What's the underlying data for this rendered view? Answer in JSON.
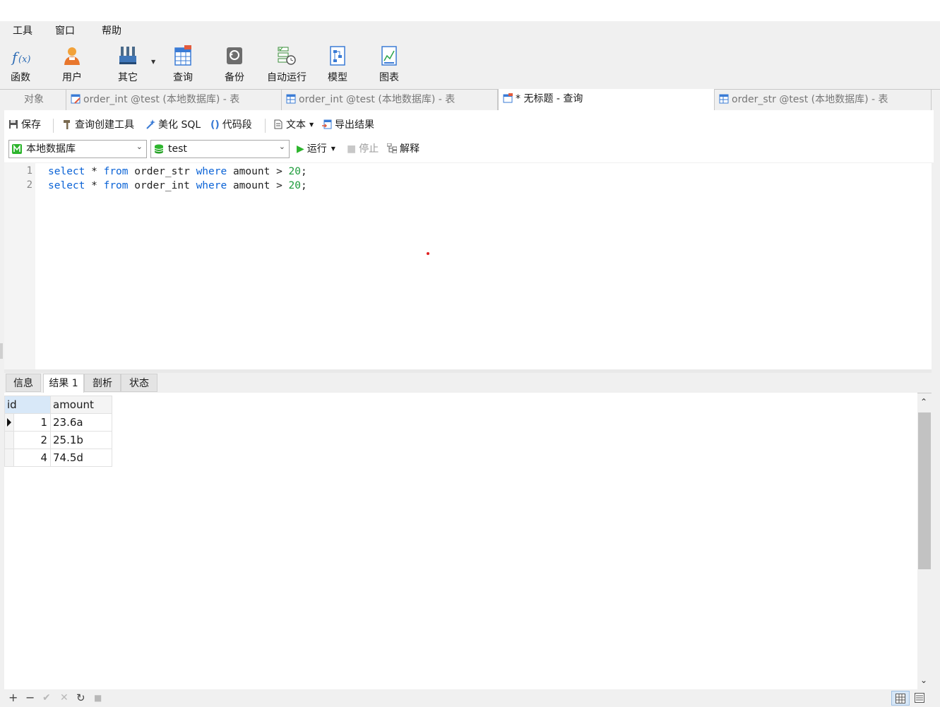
{
  "menu": [
    "工具",
    "窗口",
    "帮助"
  ],
  "ribbon": [
    {
      "label": "函数",
      "icon": "function-icon"
    },
    {
      "label": "用户",
      "icon": "user-icon"
    },
    {
      "label": "其它",
      "icon": "tools-icon"
    },
    {
      "label": "查询",
      "icon": "query-table-icon"
    },
    {
      "label": "备份",
      "icon": "backup-icon"
    },
    {
      "label": "自动运行",
      "icon": "schedule-icon"
    },
    {
      "label": "模型",
      "icon": "model-icon"
    },
    {
      "label": "图表",
      "icon": "chart-icon"
    }
  ],
  "tabs": [
    {
      "label": "对象"
    },
    {
      "label": "order_int @test (本地数据库) - 表"
    },
    {
      "label": "order_int @test (本地数据库) - 表"
    },
    {
      "label": "* 无标题 - 查询",
      "active": true
    },
    {
      "label": "order_str @test (本地数据库) - 表"
    }
  ],
  "toolbar": {
    "save": "保存",
    "query_builder": "查询创建工具",
    "beautify": "美化 SQL",
    "snippet": "代码段",
    "text": "文本",
    "export": "导出结果"
  },
  "connection": {
    "connection_value": "本地数据库",
    "database_value": "test",
    "run": "运行",
    "stop": "停止",
    "explain": "解释"
  },
  "editor": {
    "line_numbers": [
      "1",
      "2"
    ],
    "lines": [
      {
        "kw1": "select",
        "star": "*",
        "kw2": "from",
        "table": "order_str",
        "kw3": "where",
        "col": "amount",
        "op": ">",
        "val": "20",
        "end": ";"
      },
      {
        "kw1": "select",
        "star": "*",
        "kw2": "from",
        "table": "order_int",
        "kw3": "where",
        "col": "amount",
        "op": ">",
        "val": "20",
        "end": ";"
      }
    ]
  },
  "result_tabs": [
    "信息",
    "结果 1",
    "剖析",
    "状态"
  ],
  "grid": {
    "columns": [
      "id",
      "amount"
    ],
    "rows": [
      {
        "id": "1",
        "amount": "23.6a"
      },
      {
        "id": "2",
        "amount": "25.1b"
      },
      {
        "id": "4",
        "amount": "74.5d"
      }
    ]
  },
  "bottom": {
    "add": "+",
    "remove": "−",
    "apply": "✔",
    "discard": "✕",
    "refresh": "↻",
    "stop": "■"
  },
  "colors": {
    "keyword": "#0b63d6",
    "number": "#1c9b3a",
    "run_green": "#2db52d",
    "accent": "#3a7bd5"
  }
}
